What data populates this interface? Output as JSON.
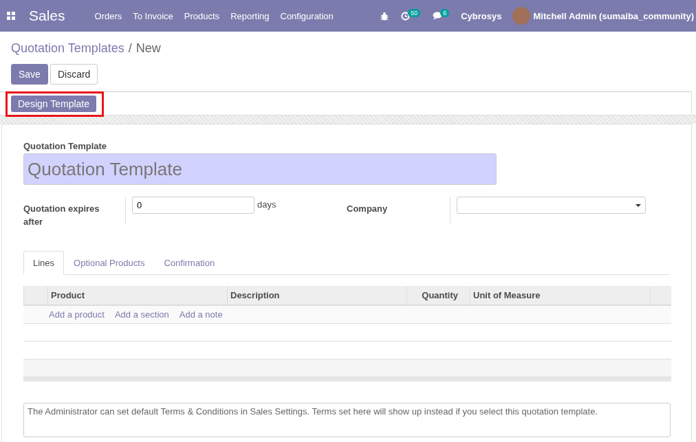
{
  "navbar": {
    "app_name": "Sales",
    "menu": [
      "Orders",
      "To Invoice",
      "Products",
      "Reporting",
      "Configuration"
    ],
    "activity_count": "50",
    "message_count": "6",
    "company": "Cybrosys",
    "user": "Mitchell Admin (sumaiba_community)"
  },
  "breadcrumb": {
    "parent": "Quotation Templates",
    "separator": "/",
    "current": "New"
  },
  "buttons": [
    {
      "label": "Save",
      "kind": "primary"
    },
    {
      "label": "Discard",
      "kind": "secondary"
    }
  ],
  "status_bar": {
    "button": "Design Template",
    "highlighted": true
  },
  "form": {
    "name_label": "Quotation Template",
    "name_placeholder": "Quotation Template",
    "fields": [
      {
        "label": "Quotation expires after",
        "kind": "number",
        "value": "0",
        "unit": "days"
      },
      {
        "label": "Company",
        "kind": "select"
      }
    ],
    "tabs": [
      {
        "label": "Lines",
        "selected": true
      },
      {
        "label": "Optional Products",
        "selected": false
      },
      {
        "label": "Confirmation",
        "selected": false
      }
    ],
    "table": {
      "columns": [
        "Product",
        "Description",
        "Quantity",
        "Unit of Measure"
      ],
      "add_links": [
        "Add a product",
        "Add a section",
        "Add a note"
      ]
    },
    "terms_placeholder": "The Administrator can set default Terms & Conditions in Sales Settings. Terms set here will show up instead if you select this quotation template."
  }
}
